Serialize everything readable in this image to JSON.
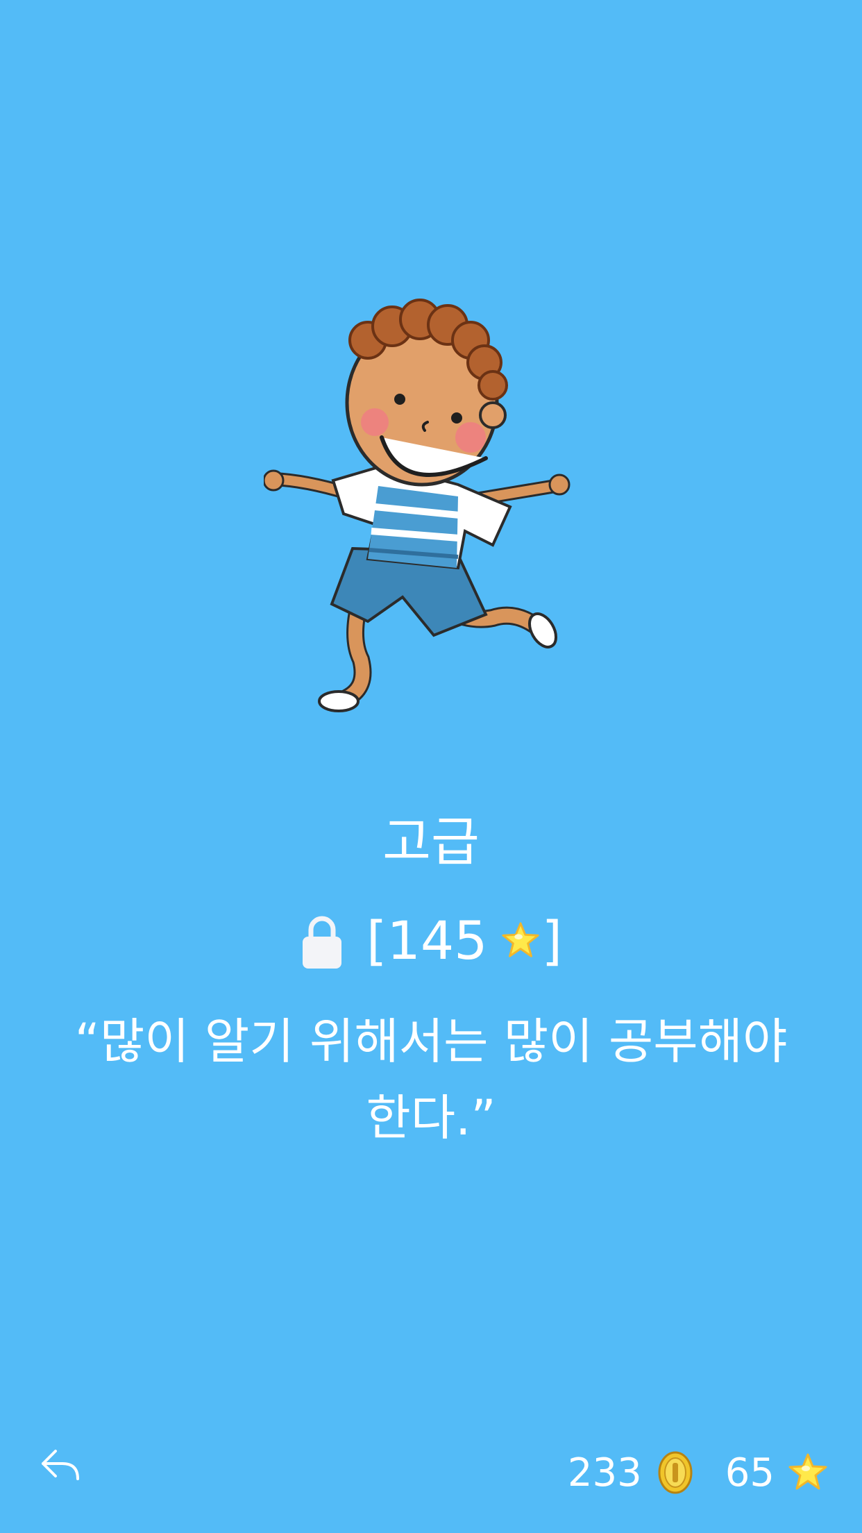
{
  "level": {
    "title": "고급",
    "unlock_bracket_open": "[",
    "unlock_cost": "145",
    "unlock_bracket_close": "]",
    "locked": true
  },
  "quote": {
    "text": "“많이 알기 위해서는 많이 공부해야 한다.”"
  },
  "footer": {
    "coins": "233",
    "stars": "65"
  },
  "icons": {
    "back": "back-arrow-icon",
    "lock": "lock-icon",
    "coin": "coin-icon",
    "star": "star-icon"
  },
  "colors": {
    "background": "#53bbf7",
    "text": "#ffffff",
    "star": "#ffe94a",
    "coin": "#f0c52a"
  }
}
